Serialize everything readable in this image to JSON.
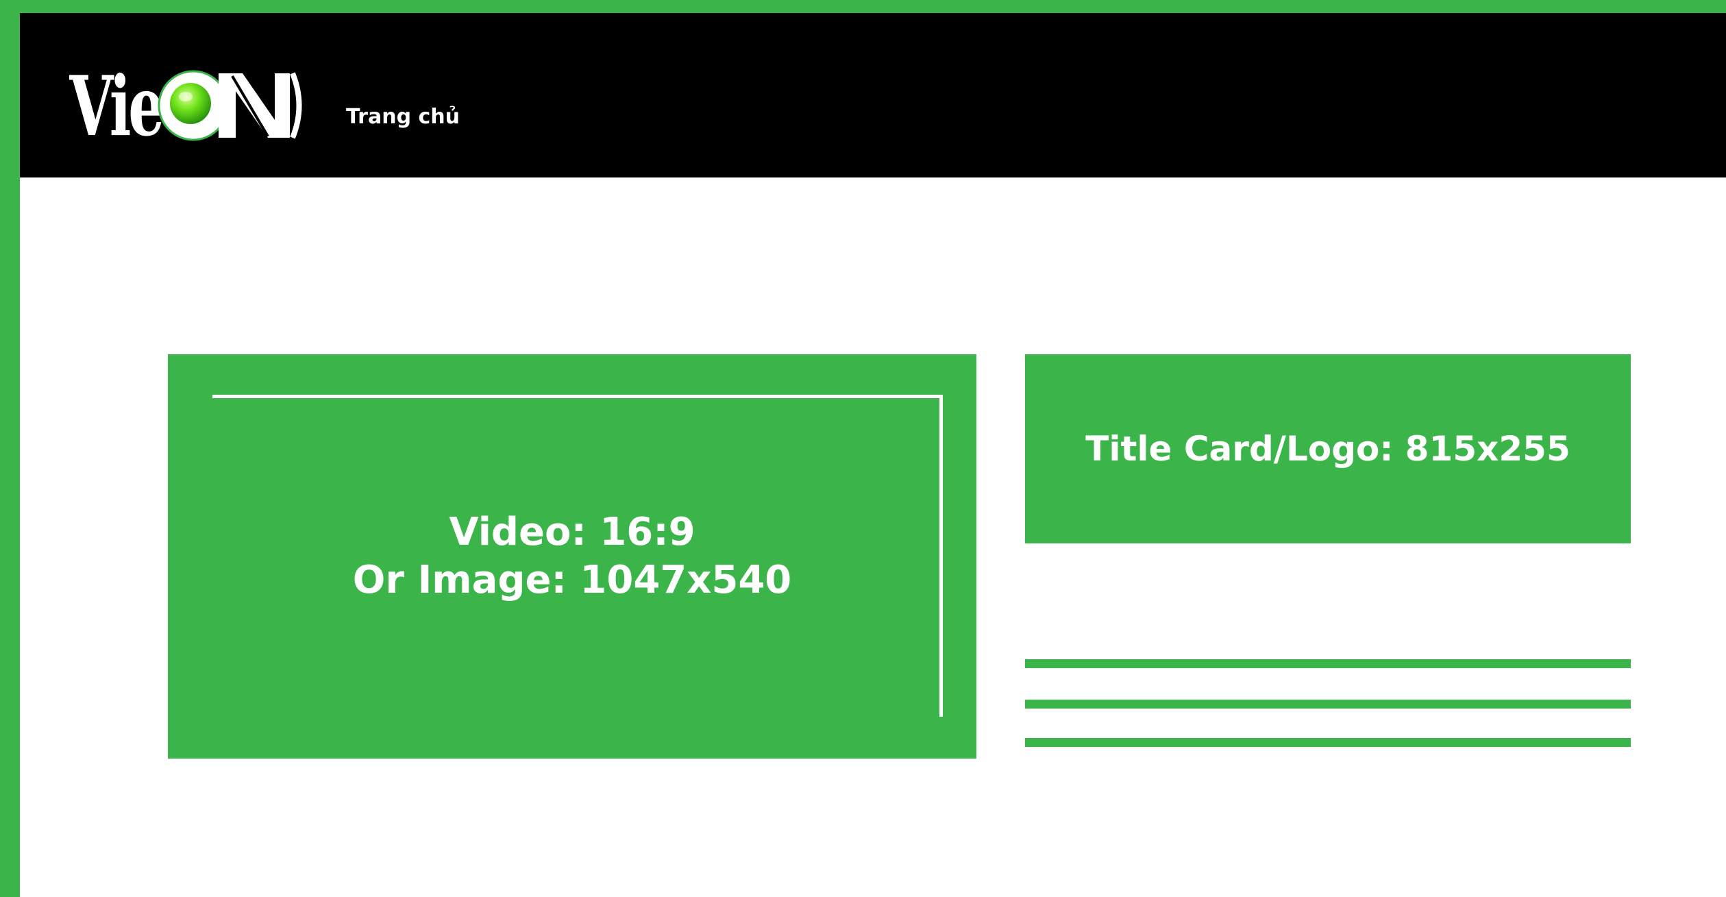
{
  "header": {
    "logo_text": "VieON",
    "nav": {
      "home_label": "Trang chủ"
    }
  },
  "main": {
    "video_placeholder": {
      "line1": "Video: 16:9",
      "line2": "Or Image: 1047x540"
    },
    "title_card": {
      "label": "Title Card/Logo: 815x255"
    },
    "description_lines": 3
  },
  "colors": {
    "accent": "#3bb44a",
    "header_bg": "#000000",
    "content_bg": "#ffffff",
    "text_on_accent": "#ffffff"
  },
  "icons": {
    "logo": "vieon-logo-icon"
  }
}
